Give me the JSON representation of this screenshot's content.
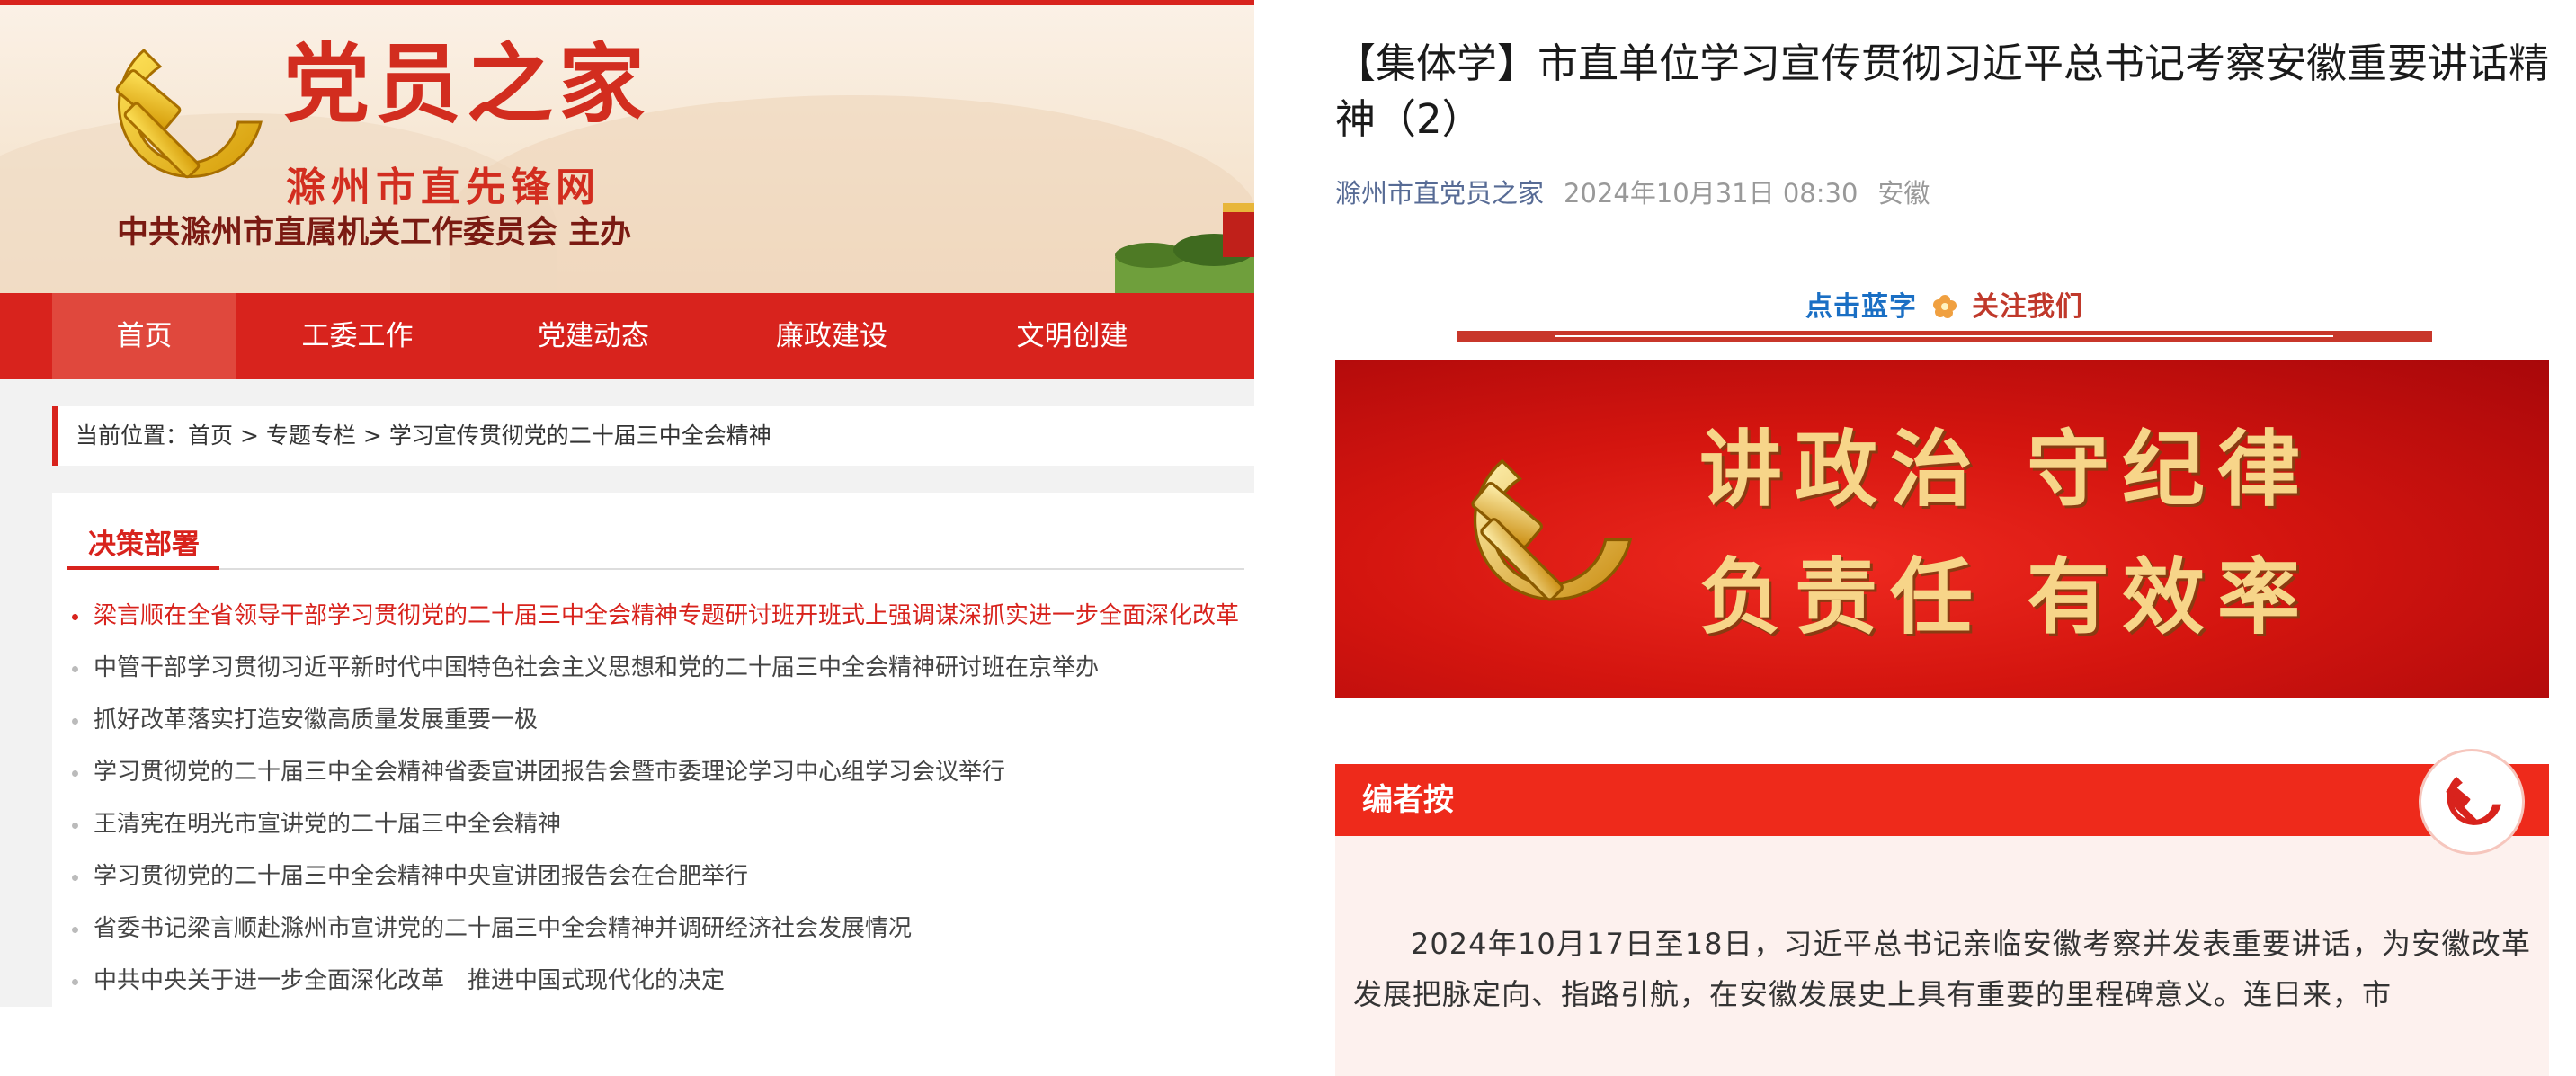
{
  "site": {
    "title": "党员之家",
    "subtitle": "滁州市直先锋网",
    "host": "中共滁州市直属机关工作委员会  主办"
  },
  "nav": {
    "items": [
      {
        "label": "首页"
      },
      {
        "label": "工委工作"
      },
      {
        "label": "党建动态"
      },
      {
        "label": "廉政建设"
      },
      {
        "label": "文明创建"
      }
    ]
  },
  "breadcrumb": {
    "prefix": "当前位置：",
    "home": "首页",
    "sep1": " > ",
    "section": "专题专栏",
    "sep2": " > ",
    "current": "学习宣传贯彻党的二十届三中全会精神"
  },
  "list": {
    "heading": "决策部署",
    "items": [
      "梁言顺在全省领导干部学习贯彻党的二十届三中全会精神专题研讨班开班式上强调谋深抓实进一步全面深化改革的",
      "中管干部学习贯彻习近平新时代中国特色社会主义思想和党的二十届三中全会精神研讨班在京举办",
      "抓好改革落实打造安徽高质量发展重要一极",
      "学习贯彻党的二十届三中全会精神省委宣讲团报告会暨市委理论学习中心组学习会议举行",
      "王清宪在明光市宣讲党的二十届三中全会精神",
      "学习贯彻党的二十届三中全会精神中央宣讲团报告会在合肥举行",
      "省委书记梁言顺赴滁州市宣讲党的二十届三中全会精神并调研经济社会发展情况",
      "中共中央关于进一步全面深化改革　推进中国式现代化的决定"
    ]
  },
  "article": {
    "title": "【集体学】市直单位学习宣传贯彻习近平总书记考察安徽重要讲话精神（2）",
    "account": "滁州市直党员之家",
    "datetime": "2024年10月31日 08:30",
    "location": "安徽",
    "follow_part1": "点击蓝字",
    "follow_part2": "关注我们",
    "slogan_line1": "讲政治 守纪律",
    "slogan_line2": "负责任 有效率",
    "editor_label": "编者按",
    "editor_text": "2024年10月17日至18日，习近平总书记亲临安徽考察并发表重要讲话，为安徽改革发展把脉定向、指路引航，在安徽发展史上具有重要的里程碑意义。连日来，市"
  },
  "colors": {
    "primary_red": "#d8231d",
    "link_blue": "#576b95",
    "follow_blue": "#1a6fc4",
    "gold": "#f7d589"
  },
  "icons": {
    "emblem": "hammer-sickle-icon",
    "flower": "flower-icon"
  }
}
